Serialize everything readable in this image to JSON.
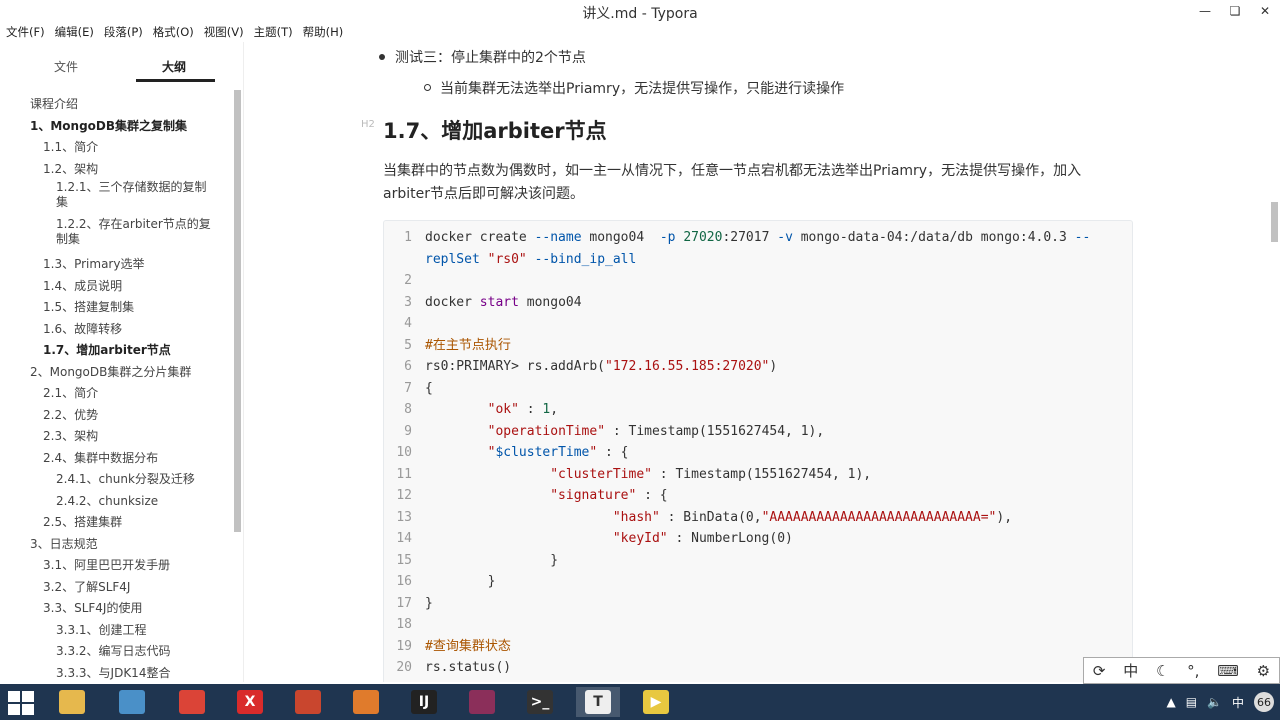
{
  "window": {
    "title": "讲义.md - Typora",
    "controls": [
      "minimize",
      "restore",
      "close"
    ]
  },
  "menu": [
    "文件(F)",
    "编辑(E)",
    "段落(P)",
    "格式(O)",
    "视图(V)",
    "主题(T)",
    "帮助(H)"
  ],
  "sidebar": {
    "tabs": [
      {
        "label": "文件",
        "active": false
      },
      {
        "label": "大纲",
        "active": true
      }
    ],
    "outline": [
      {
        "label": "课程介绍",
        "level": 0,
        "bold": false
      },
      {
        "label": "1、MongoDB集群之复制集",
        "level": 0,
        "bold": true
      },
      {
        "label": "1.1、简介",
        "level": 1,
        "bold": false
      },
      {
        "label": "1.2、架构",
        "level": 1,
        "bold": false
      },
      {
        "label": "1.2.1、三个存储数据的复制集",
        "level": 2,
        "bold": false,
        "wrap": [
          "1.2.1、三个存储数据的复制",
          "集"
        ]
      },
      {
        "label": "1.2.2、存在arbiter节点的复制集",
        "level": 2,
        "bold": false,
        "wrap": [
          "1.2.2、存在arbiter节点的复",
          "制集"
        ]
      },
      {
        "label": "1.3、Primary选举",
        "level": 1,
        "bold": false
      },
      {
        "label": "1.4、成员说明",
        "level": 1,
        "bold": false
      },
      {
        "label": "1.5、搭建复制集",
        "level": 1,
        "bold": false
      },
      {
        "label": "1.6、故障转移",
        "level": 1,
        "bold": false
      },
      {
        "label": "1.7、增加arbiter节点",
        "level": 1,
        "bold": true
      },
      {
        "label": "2、MongoDB集群之分片集群",
        "level": 0,
        "bold": false
      },
      {
        "label": "2.1、简介",
        "level": 1,
        "bold": false
      },
      {
        "label": "2.2、优势",
        "level": 1,
        "bold": false
      },
      {
        "label": "2.3、架构",
        "level": 1,
        "bold": false
      },
      {
        "label": "2.4、集群中数据分布",
        "level": 1,
        "bold": false
      },
      {
        "label": "2.4.1、chunk分裂及迁移",
        "level": 2,
        "bold": false
      },
      {
        "label": "2.4.2、chunksize",
        "level": 2,
        "bold": false
      },
      {
        "label": "2.5、搭建集群",
        "level": 1,
        "bold": false
      },
      {
        "label": "3、日志规范",
        "level": 0,
        "bold": false
      },
      {
        "label": "3.1、阿里巴巴开发手册",
        "level": 1,
        "bold": false
      },
      {
        "label": "3.2、了解SLF4J",
        "level": 1,
        "bold": false
      },
      {
        "label": "3.3、SLF4J的使用",
        "level": 1,
        "bold": false
      },
      {
        "label": "3.3.1、创建工程",
        "level": 2,
        "bold": false
      },
      {
        "label": "3.3.2、编写日志代码",
        "level": 2,
        "bold": false
      },
      {
        "label": "3.3.3、与JDK14整合",
        "level": 2,
        "bold": false
      }
    ],
    "footer_icons": [
      "chevron-left-icon",
      "code-icon"
    ],
    "footer_glyphs": [
      "‹",
      "</>"
    ]
  },
  "document": {
    "bullet_level1": "测试三：停止集群中的2个节点",
    "bullet_level2": "当前集群无法选举出Priamry，无法提供写操作，只能进行读操作",
    "heading": "1.7、增加arbiter节点",
    "paragraph_line1": "当集群中的节点数为偶数时，如一主一从情况下，任意一节点宕机都无法选举出Priamry，无法提供写操作，加入",
    "paragraph_line2": "arbiter节点后即可解决该问题。",
    "code": [
      {
        "n": "1",
        "segs": [
          [
            "",
            "docker create "
          ],
          [
            "var",
            "--name"
          ],
          [
            "",
            " mongo04  "
          ],
          [
            "var",
            "-p"
          ],
          [
            "",
            " "
          ],
          [
            "num",
            "27020"
          ],
          [
            "",
            ":27017 "
          ],
          [
            "var",
            "-v"
          ],
          [
            "",
            " mongo-data-04:/data/db mongo:4.0.3 "
          ],
          [
            "var",
            "--"
          ]
        ]
      },
      {
        "n": "",
        "segs": [
          [
            "var",
            "replSet"
          ],
          [
            "",
            " "
          ],
          [
            "str",
            "\"rs0\""
          ],
          [
            "",
            " "
          ],
          [
            "var",
            "--bind_ip_all"
          ]
        ]
      },
      {
        "n": "2",
        "segs": []
      },
      {
        "n": "3",
        "segs": [
          [
            "",
            "docker "
          ],
          [
            "kw",
            "start"
          ],
          [
            "",
            " mongo04"
          ]
        ]
      },
      {
        "n": "4",
        "segs": []
      },
      {
        "n": "5",
        "segs": [
          [
            "comment",
            "#在主节点执行"
          ]
        ]
      },
      {
        "n": "6",
        "segs": [
          [
            "",
            "rs0:PRIMARY> rs.addArb("
          ],
          [
            "str",
            "\"172.16.55.185:27020\""
          ],
          [
            "",
            ")"
          ]
        ]
      },
      {
        "n": "7",
        "segs": [
          [
            "",
            "{"
          ]
        ]
      },
      {
        "n": "8",
        "segs": [
          [
            "",
            "        "
          ],
          [
            "str",
            "\"ok\""
          ],
          [
            "",
            " : "
          ],
          [
            "num",
            "1"
          ],
          [
            "",
            ","
          ]
        ]
      },
      {
        "n": "9",
        "segs": [
          [
            "",
            "        "
          ],
          [
            "str",
            "\"operationTime\""
          ],
          [
            "",
            " : Timestamp(1551627454, 1),"
          ]
        ]
      },
      {
        "n": "10",
        "segs": [
          [
            "",
            "        "
          ],
          [
            "str",
            "\""
          ],
          [
            "var",
            "$clusterTime"
          ],
          [
            "str",
            "\""
          ],
          [
            "",
            " : {"
          ]
        ]
      },
      {
        "n": "11",
        "segs": [
          [
            "",
            "                "
          ],
          [
            "str",
            "\"clusterTime\""
          ],
          [
            "",
            " : Timestamp(1551627454, 1),"
          ]
        ]
      },
      {
        "n": "12",
        "segs": [
          [
            "",
            "                "
          ],
          [
            "str",
            "\"signature\""
          ],
          [
            "",
            " : {"
          ]
        ]
      },
      {
        "n": "13",
        "segs": [
          [
            "",
            "                        "
          ],
          [
            "str",
            "\"hash\""
          ],
          [
            "",
            " : BinData(0,"
          ],
          [
            "str",
            "\"AAAAAAAAAAAAAAAAAAAAAAAAAAA=\""
          ],
          [
            "",
            "),"
          ]
        ]
      },
      {
        "n": "14",
        "segs": [
          [
            "",
            "                        "
          ],
          [
            "str",
            "\"keyId\""
          ],
          [
            "",
            " : NumberLong(0)"
          ]
        ]
      },
      {
        "n": "15",
        "segs": [
          [
            "",
            "                }"
          ]
        ]
      },
      {
        "n": "16",
        "segs": [
          [
            "",
            "        }"
          ]
        ]
      },
      {
        "n": "17",
        "segs": [
          [
            "",
            "}"
          ]
        ]
      },
      {
        "n": "18",
        "segs": []
      },
      {
        "n": "19",
        "segs": [
          [
            "comment",
            "#查询集群状态"
          ]
        ]
      },
      {
        "n": "20",
        "segs": [
          [
            "",
            "rs.status()"
          ]
        ]
      }
    ]
  },
  "ime_toolbar": {
    "items": [
      "ime-logo-icon",
      "中",
      "moon-icon",
      "punctuation-icon",
      "keyboard-icon",
      "gear-icon"
    ],
    "glyphs": [
      "⟳",
      "中",
      "☾",
      "°,",
      "⌨",
      "⚙"
    ]
  },
  "taskbar": {
    "apps": [
      {
        "name": "file-explorer-icon",
        "color": "#e6b84d",
        "glyph": ""
      },
      {
        "name": "paint-app-icon",
        "color": "#4a90c8",
        "glyph": ""
      },
      {
        "name": "chrome-icon",
        "color": "#db4437",
        "glyph": ""
      },
      {
        "name": "xmind-icon",
        "color": "#d92b2b",
        "glyph": "X"
      },
      {
        "name": "wps-icon",
        "color": "#c9462e",
        "glyph": ""
      },
      {
        "name": "sublime-icon",
        "color": "#e07b2c",
        "glyph": ""
      },
      {
        "name": "intellij-icon",
        "color": "#222222",
        "glyph": "IJ"
      },
      {
        "name": "winrar-icon",
        "color": "#8b2f5a",
        "glyph": ""
      },
      {
        "name": "terminal-icon",
        "color": "#333333",
        "glyph": ">_"
      },
      {
        "name": "typora-icon",
        "color": "#eeeeee",
        "glyph": "T",
        "active": true
      },
      {
        "name": "player-icon",
        "color": "#e8c840",
        "glyph": "▶"
      }
    ],
    "tray": {
      "ime_label": "中",
      "badge": "66"
    }
  }
}
